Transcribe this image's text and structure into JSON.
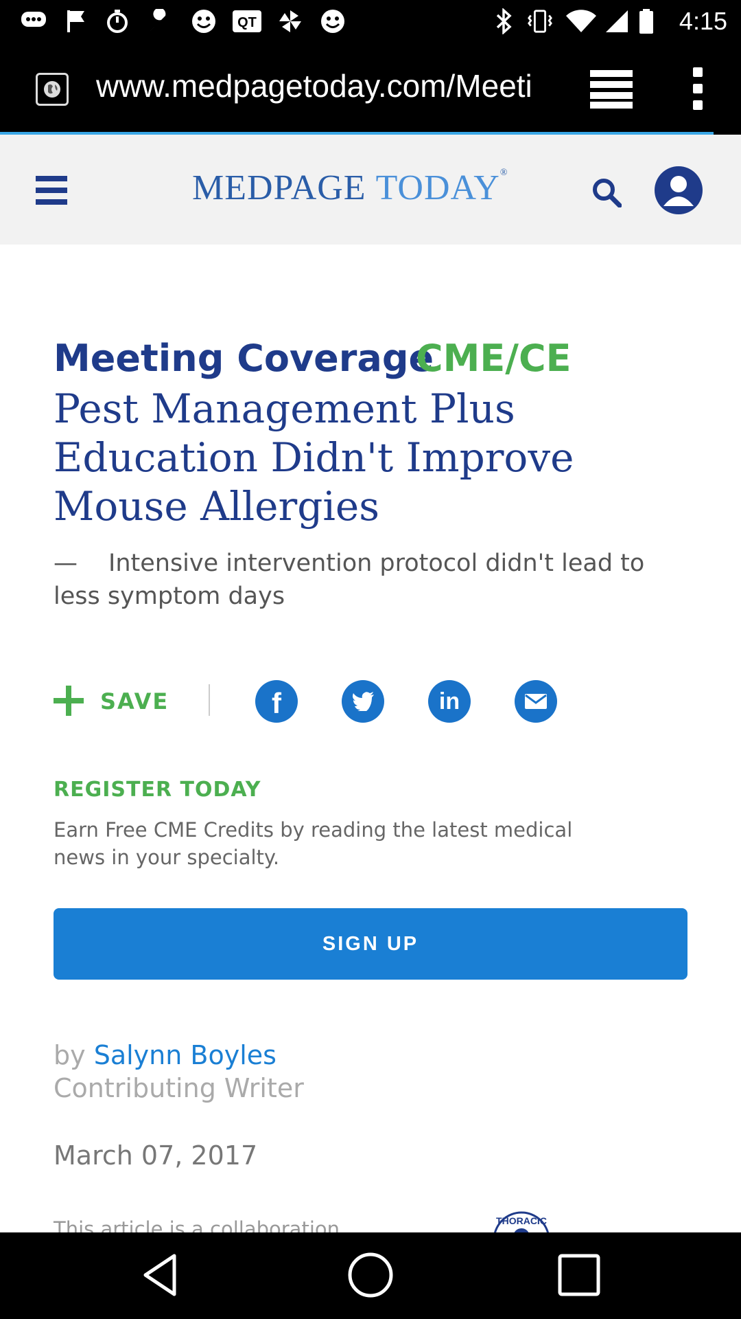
{
  "status_bar": {
    "time": "4:15",
    "icons": [
      "chat-icon",
      "flag-icon",
      "timer-icon",
      "wrench-icon",
      "smiley-icon",
      "qt-app-icon",
      "pinwheel-icon",
      "smiley-icon",
      "bluetooth-icon",
      "vibrate-icon",
      "wifi-icon",
      "signal-icon",
      "battery-icon"
    ],
    "qt_label": "QT"
  },
  "browser": {
    "url": "www.medpagetoday.com/Meeti"
  },
  "site": {
    "logo_part1": "MEDPAGE",
    "logo_part2": "TODAY",
    "logo_mark": "®"
  },
  "article": {
    "kicker": "Meeting Coverage",
    "kicker_tag": "CME/CE",
    "headline": "Pest Management Plus Education Didn't Improve Mouse Allergies",
    "dek_dash": "—",
    "dek": "Intensive intervention protocol didn't lead to less symptom days",
    "save_label": "SAVE",
    "share": {
      "facebook": "f",
      "linkedin": "in"
    },
    "register": {
      "title": "REGISTER TODAY",
      "text": "Earn Free CME Credits by reading the latest medical news in your specialty.",
      "button": "SIGN UP"
    },
    "byline_prefix": "by",
    "author": "Salynn Boyles",
    "author_role": "Contributing Writer",
    "date": "March 07, 2017",
    "collab_text": "This article is a collaboration",
    "seal_text": "THORACIC"
  },
  "colors": {
    "navy": "#1f3b8a",
    "green": "#4caf50",
    "blue": "#1a7fd4"
  }
}
